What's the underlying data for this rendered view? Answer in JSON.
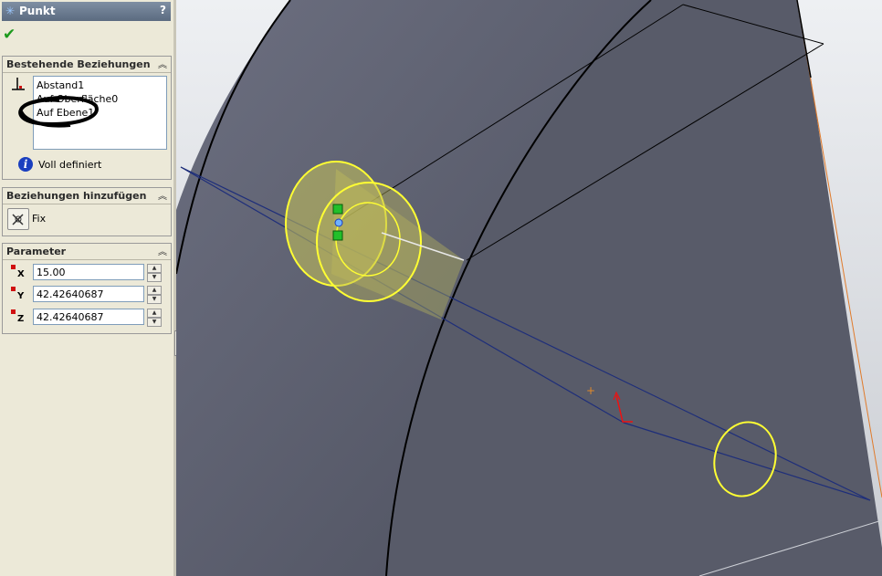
{
  "panel": {
    "title": "Punkt",
    "help": "?",
    "ok_icon": "check-icon",
    "existing_relations": {
      "title": "Bestehende Beziehungen",
      "items": [
        "Abstand1",
        "Auf Oberfläche0",
        "Auf Ebene1"
      ],
      "status": "Voll definiert"
    },
    "add_relations": {
      "title": "Beziehungen hinzufügen",
      "fix_label": "Fix"
    },
    "parameters": {
      "title": "Parameter",
      "rows": [
        {
          "axis": "X",
          "value": "15.00"
        },
        {
          "axis": "Y",
          "value": "42.42640687"
        },
        {
          "axis": "Z",
          "value": "42.42640687"
        }
      ]
    }
  },
  "colors": {
    "part_face": "#5a5d6c",
    "highlight": "#ffff33",
    "sketch_line": "#1e2e7a",
    "edge": "#000000",
    "panel_bg": "#ece9d8"
  }
}
